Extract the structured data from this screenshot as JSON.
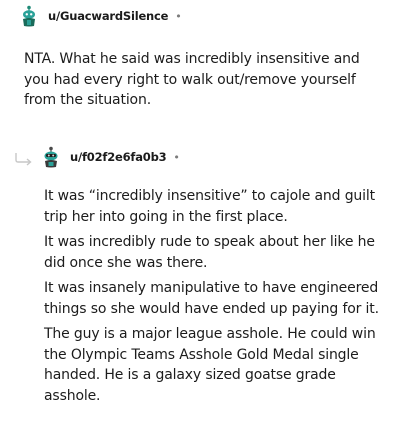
{
  "comments": [
    {
      "username": "u/GuacwardSilence",
      "separator": "•",
      "avatar_icon": "snoo-avatar-icon",
      "paragraphs": [
        "NTA. What he said was incredibly insensitive and you had every right to walk out/remove yourself from the situation."
      ]
    },
    {
      "username": "u/f02f2e6fa0b3",
      "separator": "•",
      "avatar_icon": "snoo-avatar-icon",
      "reply_icon": "reply-arrow-icon",
      "paragraphs": [
        "It was “incredibly insensitive” to cajole and guilt trip her into going in the first place.",
        "It was incredibly rude to speak about her like he did once she was there.",
        "It was insanely manipulative to have engineered things so she would have ended up paying for it.",
        "The guy is a major league asshole. He could win the Olympic Teams Asshole Gold Medal single handed. He is a galaxy sized goatse grade asshole."
      ]
    }
  ],
  "colors": {
    "text": "#1c1c1c",
    "meta": "#7c7c7c",
    "avatar_primary": "#2aa198",
    "avatar_secondary": "#1a6b5a"
  }
}
